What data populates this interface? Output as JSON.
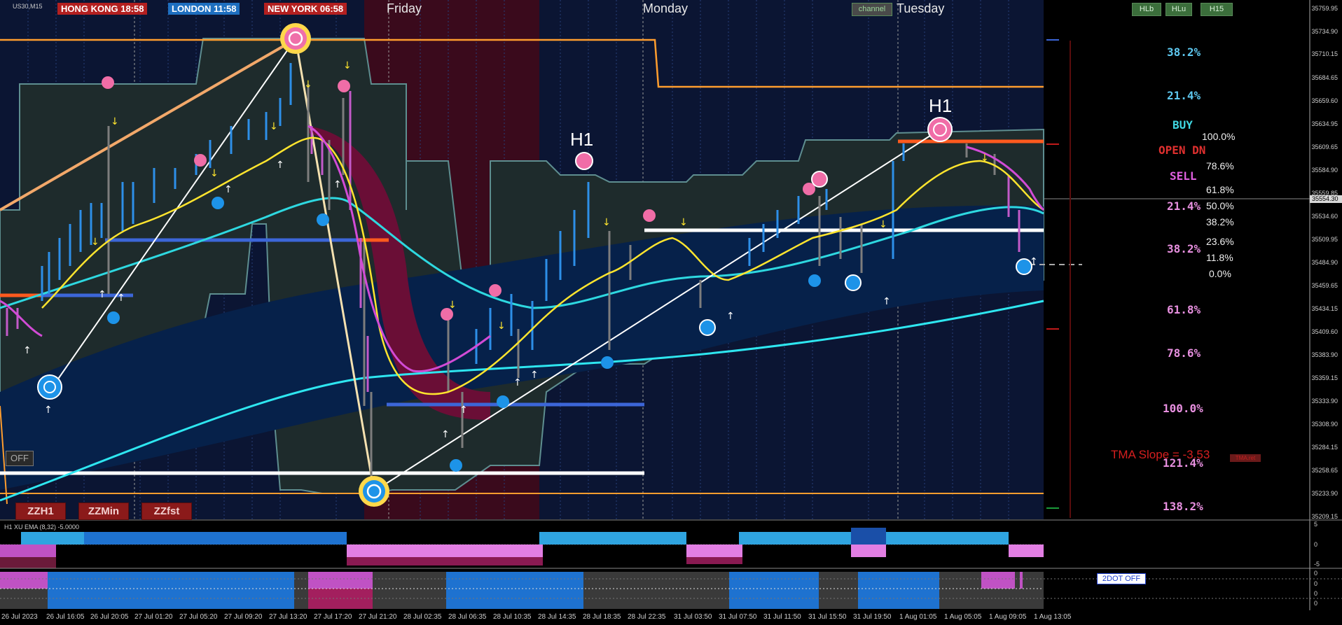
{
  "symbol": "US30,M15",
  "sessions": [
    {
      "label": "HONG KONG 18:58",
      "color": "#b32020"
    },
    {
      "label": "LONDON  11:58",
      "color": "#1e6fc0"
    },
    {
      "label": "NEW YORK 06:58",
      "color": "#b32020"
    }
  ],
  "days": [
    "Friday",
    "Monday",
    "Tuesday"
  ],
  "buttons": {
    "channel": "channel",
    "hlb": "HLb",
    "hlu": "HLu",
    "h15": "H15",
    "off": "OFF",
    "zzh1": "ZZH1",
    "zzmin": "ZZMin",
    "zzfst": "ZZfst",
    "twodot": "2DOT OFF",
    "tma_small": "TMA.ret"
  },
  "h1_labels": [
    "H1",
    "H1"
  ],
  "fib_right": [
    {
      "text": "38.2%",
      "color": "#5ec8f0"
    },
    {
      "text": "21.4%",
      "color": "#5ec8f0"
    },
    {
      "text": "BUY",
      "color": "#3fd6e0"
    },
    {
      "text": "OPEN DN",
      "color": "#e0302f"
    },
    {
      "text": "SELL",
      "color": "#e060e0"
    },
    {
      "text": "21.4%",
      "color": "#e890e0"
    },
    {
      "text": "38.2%",
      "color": "#e890e0"
    },
    {
      "text": "61.8%",
      "color": "#e890e0"
    },
    {
      "text": "78.6%",
      "color": "#e890e0"
    },
    {
      "text": "100.0%",
      "color": "#e890e0"
    },
    {
      "text": "121.4%",
      "color": "#e890e0"
    },
    {
      "text": "138.2%",
      "color": "#e890e0"
    }
  ],
  "fib_white": [
    "100.0%",
    "78.6%",
    "61.8%",
    "50.0%",
    "38.2%",
    "23.6%",
    "11.8%",
    "0.0%"
  ],
  "tma_slope": "TMA Slope = -3.53",
  "price_axis": [
    "35759.95",
    "35734.90",
    "35710.15",
    "35684.65",
    "35659.60",
    "35634.95",
    "35609.65",
    "35584.90",
    "35559.85",
    "35534.60",
    "35509.95",
    "35484.90",
    "35459.65",
    "35434.15",
    "35409.60",
    "35383.90",
    "35359.15",
    "35333.90",
    "35308.90",
    "35284.15",
    "35258.65",
    "35233.90",
    "35209.15"
  ],
  "current_price": "35554.30",
  "sub1_title": "H1 XU EMA (8,32) -5.0000",
  "sub1_axis": [
    "5",
    "0",
    "-5"
  ],
  "sub2_axis": [
    "0",
    "0",
    "0",
    "0"
  ],
  "time_axis": [
    "26 Jul 2023",
    "26 Jul 16:05",
    "26 Jul 20:05",
    "27 Jul 01:20",
    "27 Jul 05:20",
    "27 Jul 09:20",
    "27 Jul 13:20",
    "27 Jul 17:20",
    "27 Jul 21:20",
    "28 Jul 02:35",
    "28 Jul 06:35",
    "28 Jul 10:35",
    "28 Jul 14:35",
    "28 Jul 18:35",
    "28 Jul 22:35",
    "31 Jul 03:50",
    "31 Jul 07:50",
    "31 Jul 11:50",
    "31 Jul 15:50",
    "31 Jul 19:50",
    "1 Aug 01:05",
    "1 Aug 05:05",
    "1 Aug 09:05",
    "1 Aug 13:05"
  ]
}
